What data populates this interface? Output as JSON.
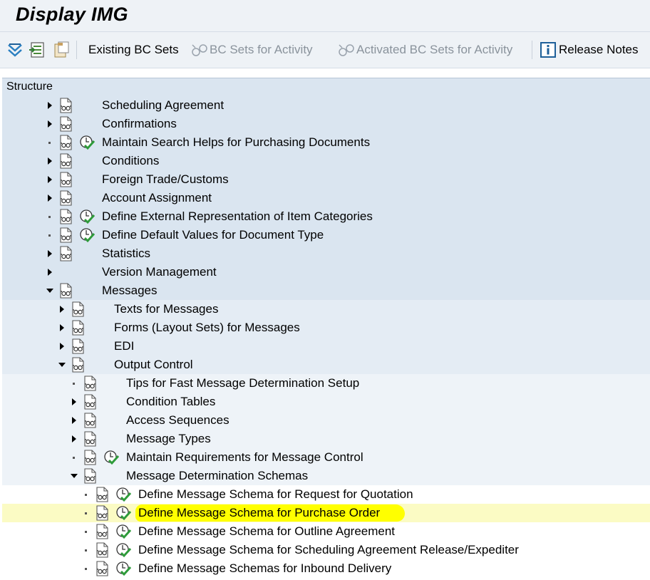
{
  "window": {
    "title": "Display IMG"
  },
  "toolbar": {
    "existing_bc_sets": "Existing BC Sets",
    "bc_sets_for_activity": "BC Sets for Activity",
    "activated_bc_sets": "Activated BC Sets for Activity",
    "release_notes": "Release Notes"
  },
  "structure": {
    "header": "Structure"
  },
  "tree": {
    "items": [
      {
        "label": "Scheduling Agreement",
        "level": 0,
        "expander": "collapsed",
        "doc": true,
        "activity": false
      },
      {
        "label": "Confirmations",
        "level": 0,
        "expander": "collapsed",
        "doc": true,
        "activity": false
      },
      {
        "label": "Maintain Search Helps for Purchasing Documents",
        "level": 0,
        "expander": "leaf",
        "doc": true,
        "activity": true
      },
      {
        "label": "Conditions",
        "level": 0,
        "expander": "collapsed",
        "doc": true,
        "activity": false
      },
      {
        "label": "Foreign Trade/Customs",
        "level": 0,
        "expander": "collapsed",
        "doc": true,
        "activity": false
      },
      {
        "label": "Account Assignment",
        "level": 0,
        "expander": "collapsed",
        "doc": true,
        "activity": false
      },
      {
        "label": "Define External Representation of Item Categories",
        "level": 0,
        "expander": "leaf",
        "doc": true,
        "activity": true
      },
      {
        "label": "Define Default Values for Document Type",
        "level": 0,
        "expander": "leaf",
        "doc": true,
        "activity": true
      },
      {
        "label": "Statistics",
        "level": 0,
        "expander": "collapsed",
        "doc": true,
        "activity": false
      },
      {
        "label": "Version Management",
        "level": 0,
        "expander": "collapsed",
        "doc": false,
        "activity": false
      },
      {
        "label": "Messages",
        "level": 0,
        "expander": "expanded",
        "doc": true,
        "activity": false
      },
      {
        "label": "Texts for Messages",
        "level": 1,
        "expander": "collapsed",
        "doc": true,
        "activity": false
      },
      {
        "label": "Forms (Layout Sets) for Messages",
        "level": 1,
        "expander": "collapsed",
        "doc": true,
        "activity": false
      },
      {
        "label": "EDI",
        "level": 1,
        "expander": "collapsed",
        "doc": true,
        "activity": false
      },
      {
        "label": "Output Control",
        "level": 1,
        "expander": "expanded",
        "doc": true,
        "activity": false
      },
      {
        "label": "Tips for Fast Message Determination Setup",
        "level": 2,
        "expander": "leaf",
        "doc": true,
        "activity": false
      },
      {
        "label": "Condition Tables",
        "level": 2,
        "expander": "collapsed",
        "doc": true,
        "activity": false
      },
      {
        "label": "Access Sequences",
        "level": 2,
        "expander": "collapsed",
        "doc": true,
        "activity": false
      },
      {
        "label": "Message Types",
        "level": 2,
        "expander": "collapsed",
        "doc": true,
        "activity": false
      },
      {
        "label": "Maintain Requirements for Message Control",
        "level": 2,
        "expander": "leaf",
        "doc": true,
        "activity": true
      },
      {
        "label": "Message Determination Schemas",
        "level": 2,
        "expander": "expanded",
        "doc": true,
        "activity": false
      },
      {
        "label": "Define Message Schema for Request for Quotation",
        "level": 3,
        "expander": "leaf",
        "doc": true,
        "activity": true
      },
      {
        "label": "Define Message Schema for Purchase Order",
        "level": 3,
        "expander": "leaf",
        "doc": true,
        "activity": true,
        "highlighted": true
      },
      {
        "label": "Define Message Schema for Outline Agreement",
        "level": 3,
        "expander": "leaf",
        "doc": true,
        "activity": true
      },
      {
        "label": "Define Message Schema for Scheduling Agreement Release/Expediter",
        "level": 3,
        "expander": "leaf",
        "doc": true,
        "activity": true
      },
      {
        "label": "Define Message Schemas for Inbound Delivery",
        "level": 3,
        "expander": "leaf",
        "doc": true,
        "activity": true
      }
    ]
  },
  "colors": {
    "level0_bg": "#dae5f0",
    "level1_bg": "#e4ecf4",
    "level2_bg": "#eef3f8",
    "level3_bg": "#ffffff",
    "highlight_row": "#fbfbc4",
    "highlight_marker": "#ffff00",
    "activity_check": "#2e9b3a"
  }
}
